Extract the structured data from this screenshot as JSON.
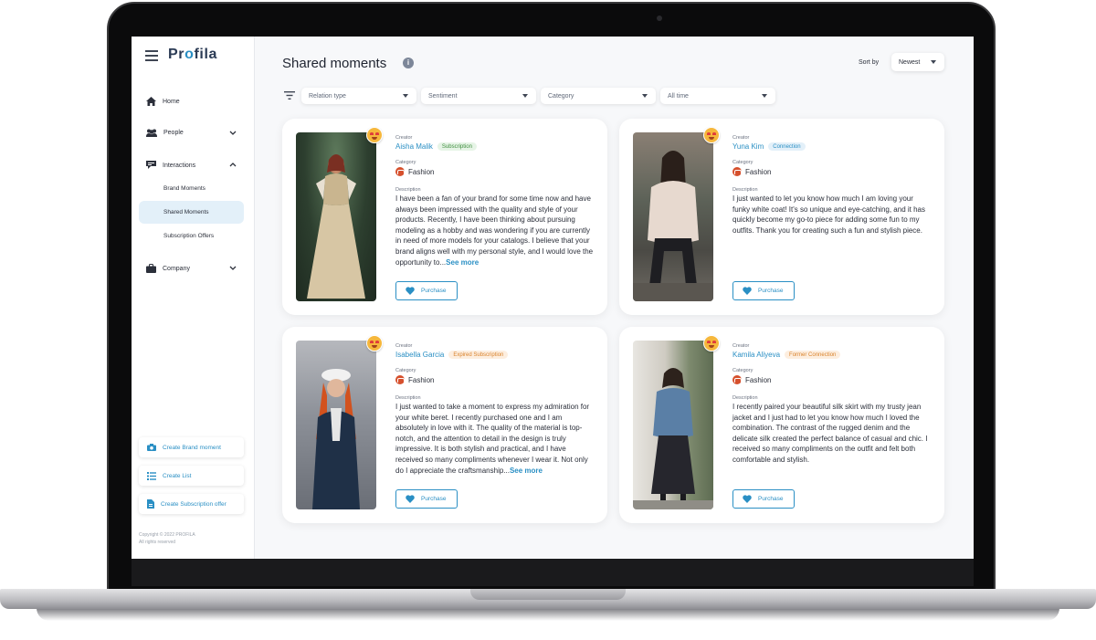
{
  "app": {
    "name_pre": "Pr",
    "name_o": "o",
    "name_post": "fila"
  },
  "nav": {
    "home": "Home",
    "people": "People",
    "interactions": "Interactions",
    "sub": [
      "Brand Moments",
      "Shared Moments",
      "Subscription Offers"
    ],
    "company": "Company"
  },
  "actions": {
    "create_brand_moment": "Create Brand moment",
    "create_list": "Create List",
    "create_subscription_offer": "Create Subscription offer"
  },
  "copyright": {
    "line1": "Copyright © 2022 PROFILA",
    "line2": "All rights reserved"
  },
  "header": {
    "title": "Shared moments",
    "sort_label": "Sort by",
    "sort_value": "Newest"
  },
  "filters": [
    "Relation type",
    "Sentiment",
    "Category",
    "All time"
  ],
  "labels": {
    "creator": "Creator",
    "category": "Category",
    "description": "Description",
    "purchase": "Purchase",
    "see_more": "See more"
  },
  "colors": {
    "accent": "#2a8fc4",
    "brand_dark": "#2b3b55"
  },
  "cards": [
    {
      "creator": "Aisha Malik",
      "badge": "Subscription",
      "category": "Fashion",
      "description": "I have been a fan of your brand for some time now and have always been impressed with the quality and style of your products. Recently, I have been thinking about pursuing modeling as a hobby and was wondering if you are currently in need of more models for your catalogs. I believe that your brand aligns well with my personal style, and I would love the opportunity to...",
      "see_more": true
    },
    {
      "creator": "Yuna Kim",
      "badge": "Connection",
      "category": "Fashion",
      "description": "I just wanted to let you know how much I am loving your funky white coat! It's so unique and eye-catching, and it has quickly become my go-to piece for adding some fun to my outfits. Thank you for creating such a fun and stylish piece.",
      "see_more": false
    },
    {
      "creator": "Isabella Garcia",
      "badge": "Expired Subscription",
      "category": "Fashion",
      "description": "I just wanted to take a moment to express my admiration for your white beret. I recently purchased one and I am absolutely in love with it. The quality of the material is top-notch, and the attention to detail in the design is truly impressive. It is both stylish and practical, and I have received so many compliments whenever I wear it. Not only do I appreciate the craftsmanship...",
      "see_more": true
    },
    {
      "creator": "Kamila Aliyeva",
      "badge": "Former Connection",
      "category": "Fashion",
      "description": "I recently paired your beautiful silk skirt with my trusty jean jacket and I just had to let you know how much I loved the combination. The contrast of the rugged denim and the delicate silk created the perfect balance of casual and chic. I received so many compliments on the outfit and felt both comfortable and stylish.",
      "see_more": false
    }
  ]
}
